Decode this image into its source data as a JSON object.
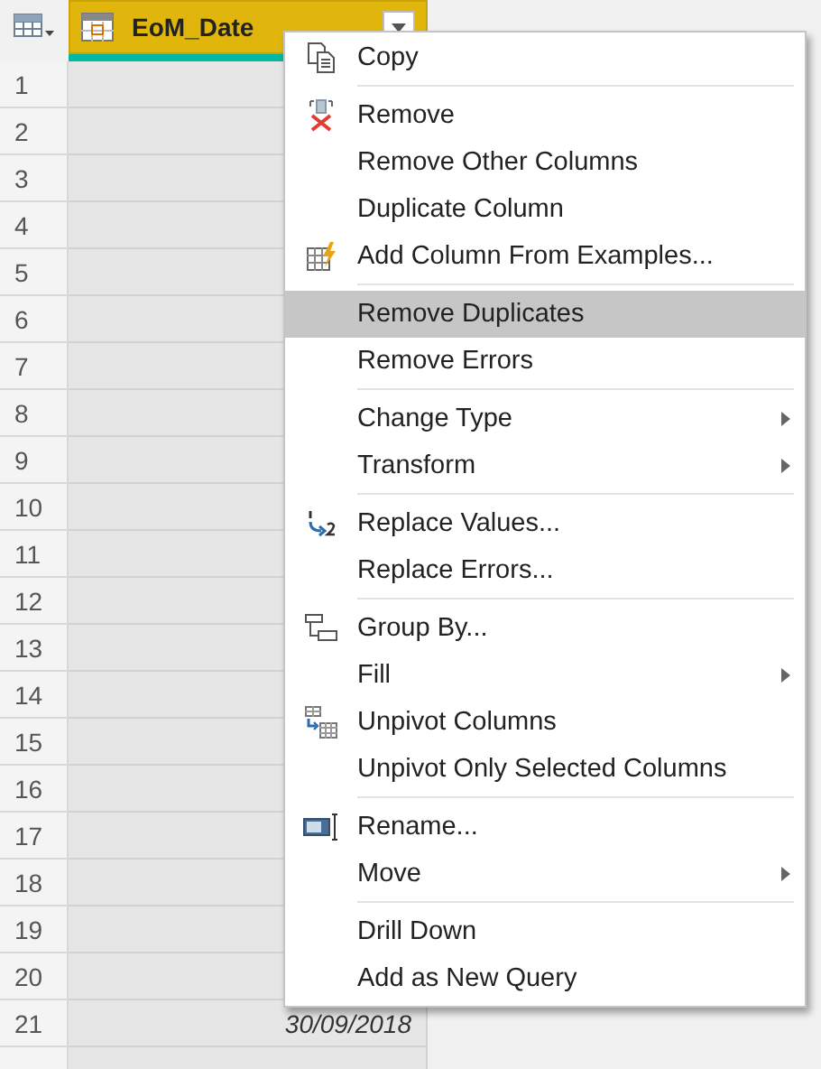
{
  "table": {
    "columns": [
      {
        "label": "EoM_Date",
        "selected": true
      }
    ],
    "rows": [
      {
        "number": "1"
      },
      {
        "number": "2"
      },
      {
        "number": "3"
      },
      {
        "number": "4"
      },
      {
        "number": "5"
      },
      {
        "number": "6"
      },
      {
        "number": "7"
      },
      {
        "number": "8"
      },
      {
        "number": "9"
      },
      {
        "number": "10"
      },
      {
        "number": "11"
      },
      {
        "number": "12"
      },
      {
        "number": "13"
      },
      {
        "number": "14"
      },
      {
        "number": "15"
      },
      {
        "number": "16"
      },
      {
        "number": "17"
      },
      {
        "number": "18"
      },
      {
        "number": "19"
      },
      {
        "number": "20"
      },
      {
        "number": "21",
        "cells": [
          "30/09/2018"
        ]
      }
    ]
  },
  "context_menu": {
    "groups": [
      [
        {
          "label": "Copy",
          "highlighted": false,
          "submenu": false
        }
      ],
      [
        {
          "label": "Remove",
          "highlighted": false,
          "submenu": false
        },
        {
          "label": "Remove Other Columns",
          "highlighted": false,
          "submenu": false
        },
        {
          "label": "Duplicate Column",
          "highlighted": false,
          "submenu": false
        },
        {
          "label": "Add Column From Examples...",
          "highlighted": false,
          "submenu": false
        }
      ],
      [
        {
          "label": "Remove Duplicates",
          "highlighted": true,
          "submenu": false
        },
        {
          "label": "Remove Errors",
          "highlighted": false,
          "submenu": false
        }
      ],
      [
        {
          "label": "Change Type",
          "highlighted": false,
          "submenu": true
        },
        {
          "label": "Transform",
          "highlighted": false,
          "submenu": true
        }
      ],
      [
        {
          "label": "Replace Values...",
          "highlighted": false,
          "submenu": false
        },
        {
          "label": "Replace Errors...",
          "highlighted": false,
          "submenu": false
        }
      ],
      [
        {
          "label": "Group By...",
          "highlighted": false,
          "submenu": false
        },
        {
          "label": "Fill",
          "highlighted": false,
          "submenu": true
        },
        {
          "label": "Unpivot Columns",
          "highlighted": false,
          "submenu": false
        },
        {
          "label": "Unpivot Only Selected Columns",
          "highlighted": false,
          "submenu": false
        }
      ],
      [
        {
          "label": "Rename...",
          "highlighted": false,
          "submenu": false
        },
        {
          "label": "Move",
          "highlighted": false,
          "submenu": true
        }
      ],
      [
        {
          "label": "Drill Down",
          "highlighted": false,
          "submenu": false
        },
        {
          "label": "Add as New Query",
          "highlighted": false,
          "submenu": false
        }
      ]
    ]
  }
}
